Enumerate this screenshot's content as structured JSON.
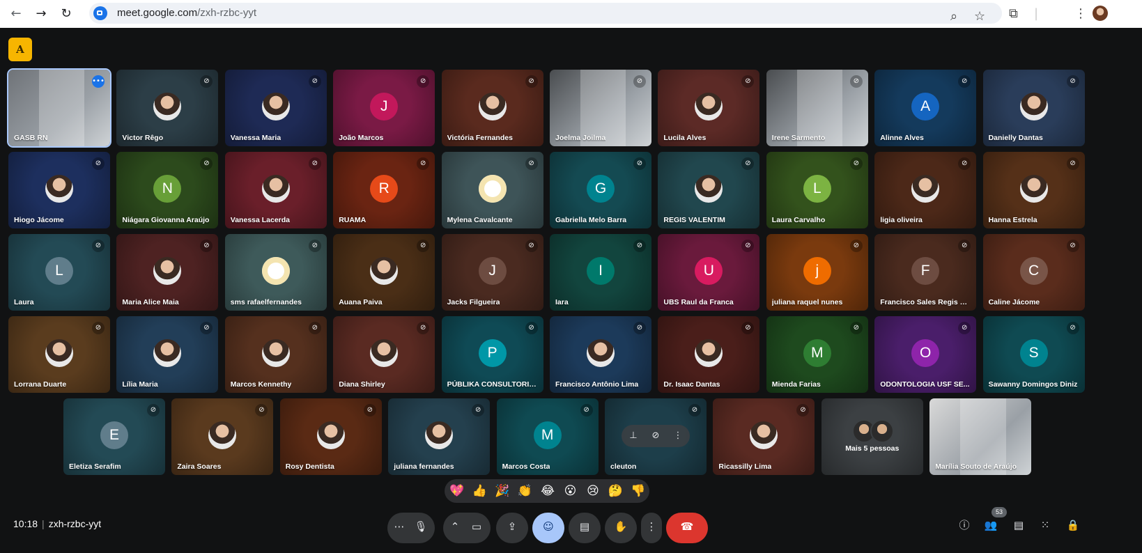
{
  "browser": {
    "url_domain": "meet.google.com",
    "url_path": "/zxh-rzbc-yyt",
    "back_icon": "arrow-left-icon",
    "forward_icon": "arrow-right-icon",
    "reload_icon": "reload-icon"
  },
  "meeting": {
    "time": "10:18",
    "code": "zxh-rzbc-yyt",
    "participant_count": "53"
  },
  "app_badge": "A",
  "colors": {
    "mic_off_badge": "#3c4043",
    "selected_outline": "#a8c7fa",
    "end_call": "#dc362e"
  },
  "tiles": [
    {
      "name": "GASB RN",
      "initial": "",
      "color": "#6f7378",
      "kind": "video",
      "mic": "speaking"
    },
    {
      "name": "Victor Rêgo",
      "initial": "",
      "color": "#2c3e47",
      "kind": "photo",
      "mic": "off"
    },
    {
      "name": "Vanessa Maria",
      "initial": "",
      "color": "#1e2a55",
      "kind": "photo",
      "mic": "off"
    },
    {
      "name": "João Marcos",
      "initial": "J",
      "color": "#7a1a45",
      "avatarColor": "#c2185b",
      "kind": "initial",
      "mic": "off"
    },
    {
      "name": "Victória Fernandes",
      "initial": "",
      "color": "#5a2a1e",
      "kind": "photo",
      "mic": "off"
    },
    {
      "name": "Joelma Joilma",
      "initial": "",
      "color": "#4a4d50",
      "kind": "video",
      "mic": "off"
    },
    {
      "name": "Lucila Alves",
      "initial": "",
      "color": "#5c2a26",
      "kind": "photo",
      "mic": "off"
    },
    {
      "name": "Irene Sarmento",
      "initial": "",
      "color": "#4a4d50",
      "kind": "video",
      "mic": "off"
    },
    {
      "name": "Alinne Alves",
      "initial": "A",
      "color": "#143a5c",
      "avatarColor": "#1565c0",
      "kind": "initial",
      "mic": "off"
    },
    {
      "name": "Danielly Dantas",
      "initial": "",
      "color": "#2a3d5a",
      "kind": "photo",
      "mic": "off"
    },
    {
      "name": "Hiogo Jácome",
      "initial": "",
      "color": "#1d2f5e",
      "kind": "photo",
      "mic": "off"
    },
    {
      "name": "Niágara Giovanna Araújo",
      "initial": "N",
      "color": "#2c4a1c",
      "avatarColor": "#689f38",
      "kind": "initial",
      "mic": "off"
    },
    {
      "name": "Vanessa Lacerda",
      "initial": "",
      "color": "#6a1f2a",
      "kind": "photo",
      "mic": "off"
    },
    {
      "name": "RUAMA",
      "initial": "R",
      "color": "#6a2412",
      "avatarColor": "#e64a19",
      "kind": "initial",
      "mic": "off"
    },
    {
      "name": "Mylena Cavalcante",
      "initial": "",
      "color": "#3e5458",
      "kind": "logo",
      "mic": "off"
    },
    {
      "name": "Gabriella Melo Barra",
      "initial": "G",
      "color": "#144a52",
      "avatarColor": "#00838f",
      "kind": "initial",
      "mic": "off"
    },
    {
      "name": "REGIS VALENTIM",
      "initial": "",
      "color": "#21474e",
      "kind": "photo",
      "mic": "off"
    },
    {
      "name": "Laura Carvalho",
      "initial": "L",
      "color": "#33521c",
      "avatarColor": "#7cb342",
      "kind": "initial",
      "mic": "off"
    },
    {
      "name": "ligia oliveira",
      "initial": "",
      "color": "#4c2818",
      "kind": "photo",
      "mic": "off"
    },
    {
      "name": "Hanna Estrela",
      "initial": "",
      "color": "#553018",
      "kind": "photo",
      "mic": "off"
    },
    {
      "name": "Laura",
      "initial": "L",
      "color": "#234a55",
      "avatarColor": "#607d8b",
      "kind": "initial",
      "mic": "off"
    },
    {
      "name": "Maria Alice Maia",
      "initial": "",
      "color": "#4e2222",
      "kind": "photo",
      "mic": "off"
    },
    {
      "name": "sms rafaelfernandes",
      "initial": "",
      "color": "#3e5a5a",
      "kind": "logo",
      "mic": "off"
    },
    {
      "name": "Auana Paiva",
      "initial": "",
      "color": "#4a2e16",
      "kind": "photo",
      "mic": "off"
    },
    {
      "name": "Jacks Filgueira",
      "initial": "J",
      "color": "#4a2a20",
      "avatarColor": "#6d4c41",
      "kind": "initial",
      "mic": "off"
    },
    {
      "name": "Iara",
      "initial": "I",
      "color": "#12453e",
      "avatarColor": "#00796b",
      "kind": "initial",
      "mic": "off"
    },
    {
      "name": "UBS Raul da Franca",
      "initial": "U",
      "color": "#6a1a3c",
      "avatarColor": "#d81b60",
      "kind": "initial",
      "mic": "off"
    },
    {
      "name": "juliana raquel nunes",
      "initial": "j",
      "color": "#7a3a0e",
      "avatarColor": "#ef6c00",
      "kind": "initial",
      "mic": "off"
    },
    {
      "name": "Francisco Sales Regis B...",
      "initial": "F",
      "color": "#4a2a1e",
      "avatarColor": "#6d4c41",
      "kind": "initial",
      "mic": "off"
    },
    {
      "name": "Caline Jácome",
      "initial": "C",
      "color": "#5a2c1c",
      "avatarColor": "#795548",
      "kind": "initial",
      "mic": "off"
    },
    {
      "name": "Lorrana Duarte",
      "initial": "",
      "color": "#5a3c1e",
      "kind": "photo",
      "mic": "off"
    },
    {
      "name": "Lília Maria",
      "initial": "",
      "color": "#223e58",
      "kind": "photo",
      "mic": "off"
    },
    {
      "name": "Marcos Kennethy",
      "initial": "",
      "color": "#55301e",
      "kind": "photo",
      "mic": "off"
    },
    {
      "name": "Diana Shirley",
      "initial": "",
      "color": "#5a2a22",
      "kind": "photo",
      "mic": "off"
    },
    {
      "name": "PÚBLIKA CONSULTORIA...",
      "initial": "P",
      "color": "#0f4a55",
      "avatarColor": "#0097a7",
      "kind": "initial",
      "mic": "off"
    },
    {
      "name": "Francisco Antônio Lima",
      "initial": "",
      "color": "#1c3a5a",
      "kind": "photo",
      "mic": "off"
    },
    {
      "name": "Dr. Isaac Dantas",
      "initial": "",
      "color": "#4a1e1a",
      "kind": "photo",
      "mic": "off"
    },
    {
      "name": "Mienda Farias",
      "initial": "M",
      "color": "#1e4a1e",
      "avatarColor": "#2e7d32",
      "kind": "initial",
      "mic": "off"
    },
    {
      "name": "ODONTOLOGIA USF SE...",
      "initial": "O",
      "color": "#4a1e6a",
      "avatarColor": "#8e24aa",
      "kind": "initial",
      "mic": "off"
    },
    {
      "name": "Sawanny Domingos Diniz",
      "initial": "S",
      "color": "#0f4a52",
      "avatarColor": "#00838f",
      "kind": "initial",
      "mic": "off"
    }
  ],
  "last_row": [
    {
      "name": "Eletiza Serafim",
      "initial": "E",
      "color": "#234a55",
      "avatarColor": "#607d8b",
      "kind": "initial",
      "mic": "off"
    },
    {
      "name": "Zaira Soares",
      "initial": "",
      "color": "#5a3a1e",
      "kind": "photo",
      "mic": "off"
    },
    {
      "name": "Rosy Dentista",
      "initial": "",
      "color": "#5a2a14",
      "kind": "photo",
      "mic": "off"
    },
    {
      "name": "juliana fernandes",
      "initial": "",
      "color": "#24404e",
      "kind": "photo",
      "mic": "off"
    },
    {
      "name": "Marcos Costa",
      "initial": "M",
      "color": "#0f4a52",
      "avatarColor": "#00838f",
      "kind": "initial",
      "mic": "off"
    },
    {
      "name": "cleuton",
      "initial": "",
      "color": "#1d3e4a",
      "kind": "hover",
      "mic": "off"
    },
    {
      "name": "Ricassilly Lima",
      "initial": "",
      "color": "#5a2a22",
      "kind": "photo",
      "mic": "off"
    },
    {
      "name": "Mais 5 pessoas",
      "initial": "",
      "color": "#3c4043",
      "kind": "more",
      "mic": ""
    },
    {
      "name": "Marília Souto de Araújo",
      "initial": "",
      "color": "#d9d9d9",
      "kind": "video",
      "mic": ""
    }
  ],
  "reactions": [
    "💖",
    "👍",
    "🎉",
    "👏",
    "😂",
    "😮",
    "😢",
    "🤔",
    "👎"
  ],
  "controls": {
    "more_options_icon": "ellipsis-icon",
    "mic_icon": "microphone-icon",
    "camera_icon": "camera-icon",
    "present_icon": "present-screen-icon",
    "emoji_icon": "emoji-icon",
    "captions_icon": "captions-icon",
    "raise_hand_icon": "raise-hand-icon",
    "more_vert_icon": "more-vert-icon",
    "end_call_icon": "end-call-icon"
  }
}
